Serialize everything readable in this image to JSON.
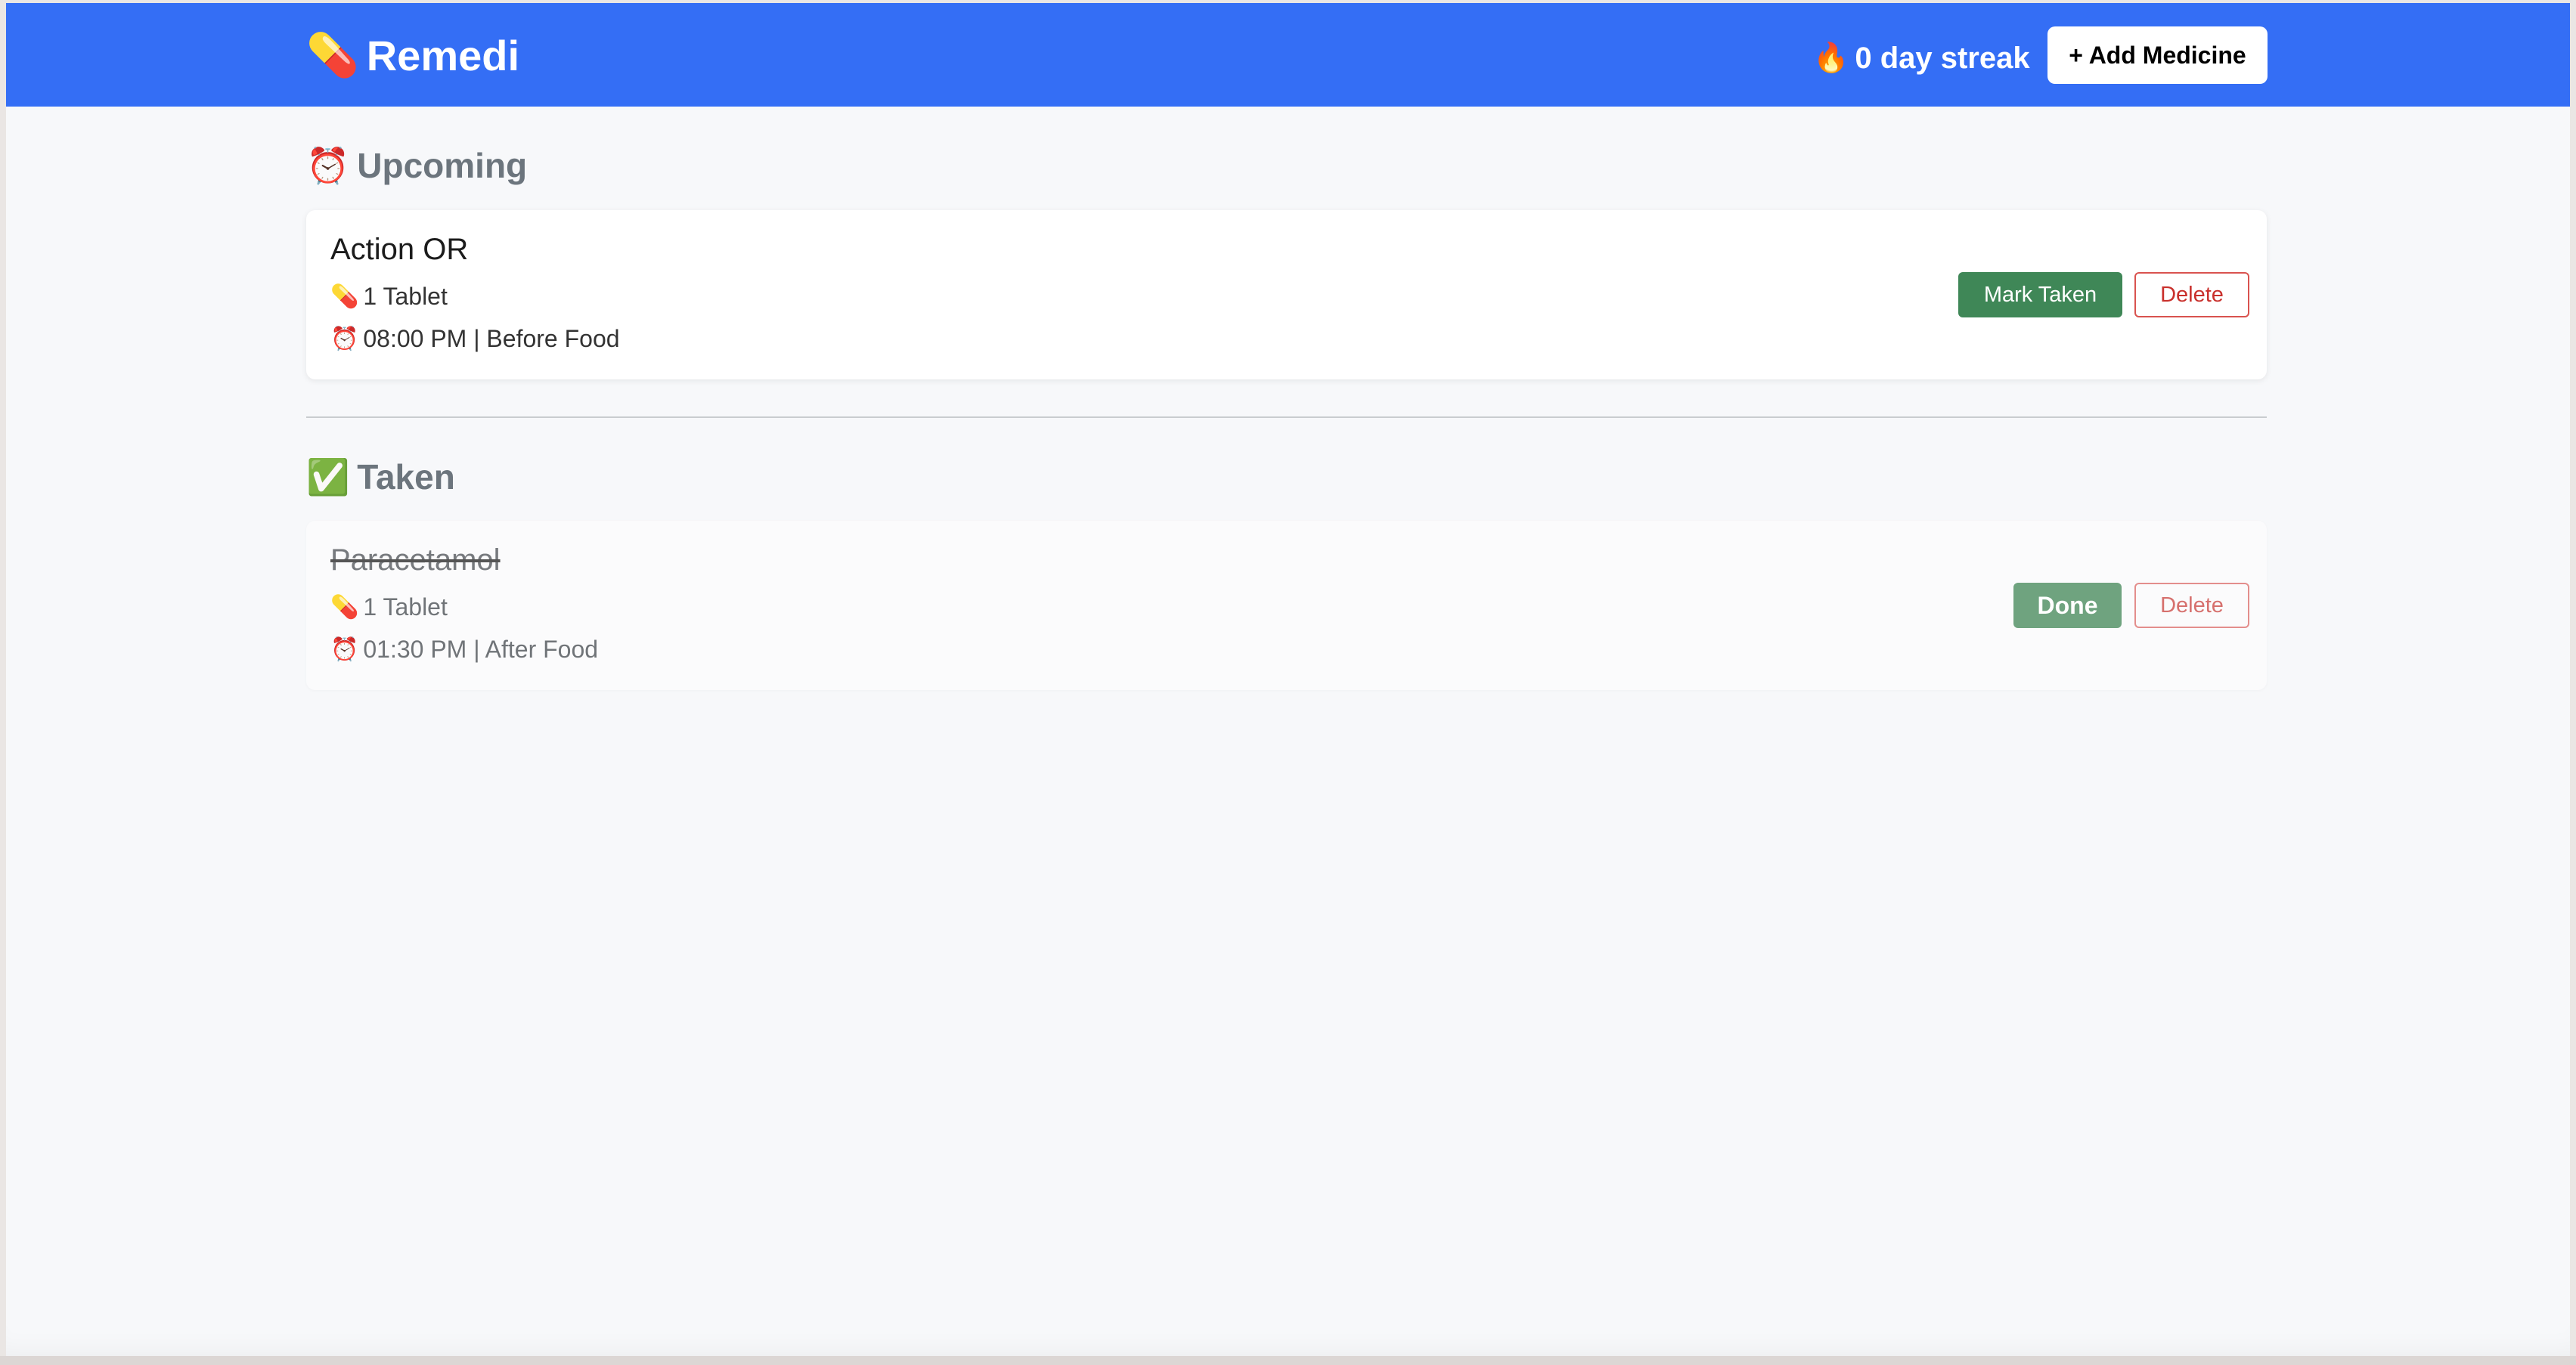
{
  "header": {
    "brand_icon": "💊",
    "brand_title": "Remedi",
    "streak_icon": "🔥",
    "streak_text": "0 day streak",
    "add_button_label": "+ Add Medicine",
    "background_color": "#346ef5"
  },
  "sections": {
    "upcoming": {
      "icon": "⏰",
      "title": "Upcoming",
      "items": [
        {
          "name": "Action OR",
          "dose_icon": "💊",
          "dose": "1 Tablet",
          "time_icon": "⏰",
          "schedule": "08:00 PM | Before Food",
          "primary_action": "Mark Taken",
          "delete_action": "Delete"
        }
      ]
    },
    "taken": {
      "icon": "✅",
      "title": "Taken",
      "items": [
        {
          "name": "Paracetamol",
          "dose_icon": "💊",
          "dose": "1 Tablet",
          "time_icon": "⏰",
          "schedule": "01:30 PM | After Food",
          "primary_action": "Done",
          "delete_action": "Delete"
        }
      ]
    }
  },
  "colors": {
    "mark_taken": "#3f8757",
    "done": "#6fa37f",
    "delete": "#d9534f"
  }
}
